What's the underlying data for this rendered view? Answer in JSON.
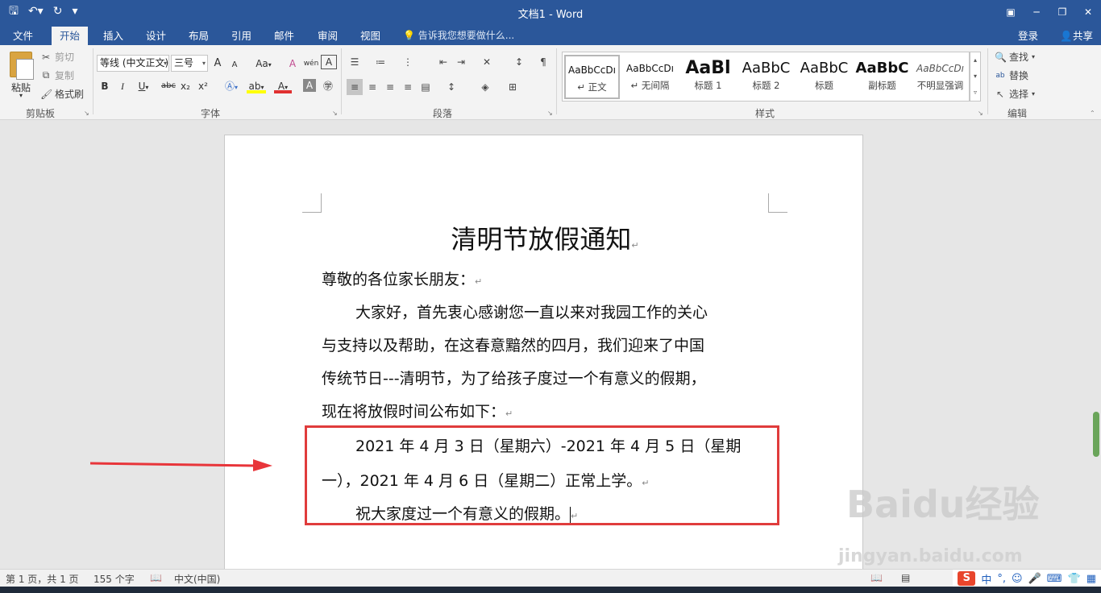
{
  "window": {
    "title": "文档1 - Word",
    "qat": [
      "save-icon",
      "undo-icon",
      "redo-icon",
      "customize-icon"
    ]
  },
  "tabs": {
    "file": "文件",
    "home": "开始",
    "insert": "插入",
    "design": "设计",
    "layout": "布局",
    "references": "引用",
    "mailings": "邮件",
    "review": "审阅",
    "view": "视图",
    "tell_me": "告诉我您想要做什么...",
    "login": "登录",
    "share": "共享"
  },
  "clipboard": {
    "paste": "粘贴",
    "cut": "剪切",
    "copy": "复制",
    "format_painter": "格式刷",
    "group_label": "剪贴板"
  },
  "font": {
    "font_name": "等线 (中文正文)",
    "font_size": "三号",
    "group_label": "字体",
    "bold": "B",
    "italic": "I",
    "underline": "U",
    "strike": "abc",
    "subscript": "x₂",
    "superscript": "x²",
    "grow": "A",
    "shrink": "A",
    "case": "Aa",
    "clear": "A",
    "phonetic": "wén",
    "border": "A"
  },
  "paragraph": {
    "group_label": "段落"
  },
  "styles": {
    "group_label": "样式",
    "items": [
      {
        "sample": "AaBbCcDı",
        "name": "↵ 正文"
      },
      {
        "sample": "AaBbCcDı",
        "name": "↵ 无间隔"
      },
      {
        "sample": "AaBl",
        "name": "标题 1"
      },
      {
        "sample": "AaBbC",
        "name": "标题 2"
      },
      {
        "sample": "AaBbC",
        "name": "标题"
      },
      {
        "sample": "AaBbC",
        "name": "副标题"
      },
      {
        "sample": "AaBbCcDı",
        "name": "不明显强调"
      }
    ]
  },
  "editing": {
    "find": "查找",
    "replace": "替换",
    "select": "选择",
    "group_label": "编辑"
  },
  "document": {
    "title": "清明节放假通知",
    "salutation": "尊敬的各位家长朋友：",
    "body_line1": "大家好，首先衷心感谢您一直以来对我园工作的关心",
    "body_line2": "与支持以及帮助，在这春意黯然的四月，我们迎来了中国",
    "body_line3": "传统节日---清明节，为了给孩子度过一个有意义的假期，",
    "body_line4": "现在将放假时间公布如下：",
    "date_line1": "2021 年 4 月 3 日（星期六）-2021 年 4 月 5 日（星期",
    "date_line2": "一），2021 年 4 月 6 日（星期二）正常上学。",
    "closing": "祝大家度过一个有意义的假期。",
    "para_mark": "↵"
  },
  "status": {
    "page": "第 1 页，共 1 页",
    "words": "155 个字",
    "language": "中文(中国)"
  },
  "ime": {
    "logo": "S",
    "mode": "中",
    "punct": "°,"
  },
  "watermark": {
    "brand": "Baidu经验",
    "url": "jingyan.baidu.com"
  },
  "colors": {
    "title_bar": "#2b579a",
    "highlight": "#e03c3c",
    "arrow": "#e8353a"
  }
}
